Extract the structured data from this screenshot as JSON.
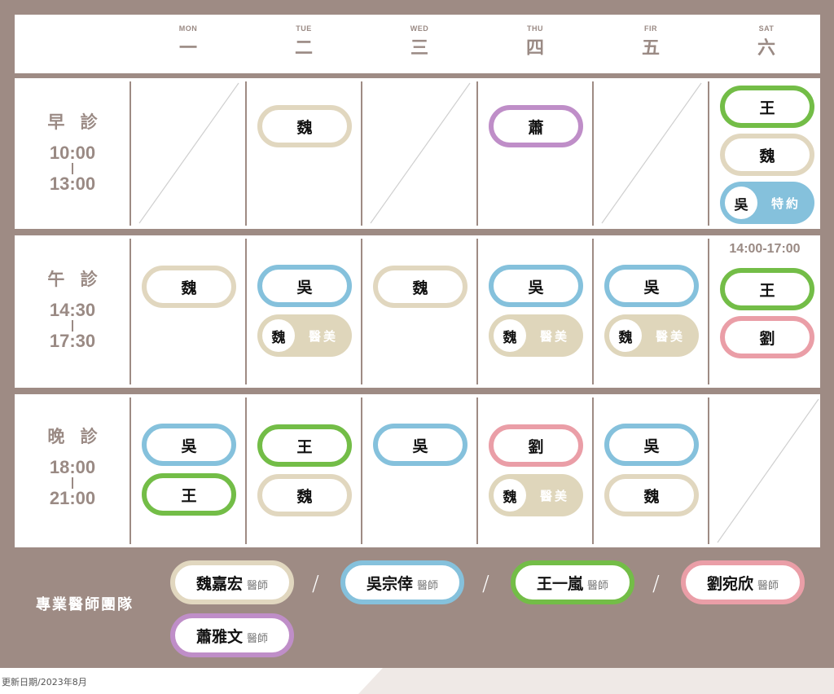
{
  "days": [
    {
      "en": "MON",
      "zh": "一"
    },
    {
      "en": "TUE",
      "zh": "二"
    },
    {
      "en": "WED",
      "zh": "三"
    },
    {
      "en": "THU",
      "zh": "四"
    },
    {
      "en": "FIR",
      "zh": "五"
    },
    {
      "en": "SAT",
      "zh": "六"
    }
  ],
  "sessions": [
    {
      "name": "早 診",
      "start": "10:00",
      "end": "13:00"
    },
    {
      "name": "午 診",
      "start": "14:30",
      "end": "17:30"
    },
    {
      "name": "晚 診",
      "start": "18:00",
      "end": "21:00"
    }
  ],
  "doctors": {
    "wei": "魏",
    "wu": "吳",
    "wang": "王",
    "liu": "劉",
    "xiao": "蕭"
  },
  "labels": {
    "aesthetic": "醫美",
    "appointment": "特約",
    "sat_afternoon_time": "14:00-17:00"
  },
  "colors": {
    "wei": "#e1d7bf",
    "wu": "#85c1dc",
    "wang": "#73bd47",
    "liu": "#ea9ea7",
    "xiao": "#bf8ec8",
    "background": "#9e8b84"
  },
  "team": {
    "title": "專業醫師團隊",
    "members": [
      {
        "name": "魏嘉宏",
        "title": "醫師"
      },
      {
        "name": "吳宗倖",
        "title": "醫師"
      },
      {
        "name": "王一嵐",
        "title": "醫師"
      },
      {
        "name": "劉宛欣",
        "title": "醫師"
      },
      {
        "name": "蕭雅文",
        "title": "醫師"
      }
    ]
  },
  "footer": "更新日期/2023年8月"
}
